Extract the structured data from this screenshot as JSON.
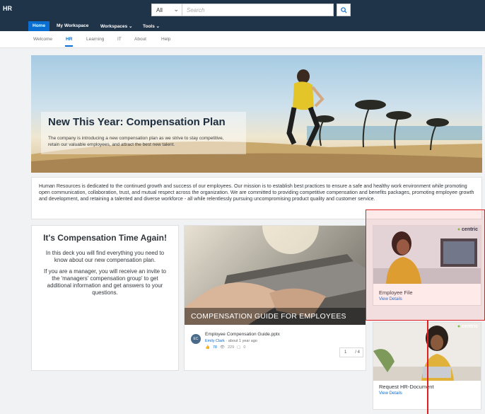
{
  "app": {
    "title": "HR"
  },
  "search": {
    "scope": "All",
    "placeholder": "Search"
  },
  "nav": {
    "items": [
      "Home",
      "My Workspace",
      "Workspaces ⌄",
      "Tools ⌄"
    ]
  },
  "subnav": {
    "items": [
      "Welcome",
      "HR",
      "Learning",
      "IT",
      "About",
      "Help"
    ]
  },
  "hero": {
    "title": "New This Year: Compensation Plan",
    "subtitle": "The company is introducing a new compensation plan as we strive to stay competitive, retain our valuable employees, and attract the best new talent."
  },
  "mission": {
    "text": "Human Resources is dedicated to the continued growth and success of our employees. Our mission is to establish best practices to ensure a safe and healthy work environment while promoting open communication, collaboration, trust, and mutual respect across the organization. We are committed to providing competitive compensation and benefits packages, promoting employee growth and development, and retaining a talented and diverse workforce - all while relentlessly pursuing uncompromising product quality and customer service."
  },
  "comp_card": {
    "title": "It's Compensation Time Again!",
    "p1": "In this deck you will find everything you need to know about our new compensation plan.",
    "p2": "If you are a manager, you will receive an invite to the 'managers' compensation group' to get additional information and get answers to your questions."
  },
  "guide": {
    "banner": "COMPENSATION GUIDE FOR EMPLOYEES",
    "file": "Employee Compensation Guide.pptx",
    "author": "Emily Clark",
    "time": " · about 1 year ago",
    "avatar": "EC",
    "likes": "78",
    "views": "229",
    "comments": "0",
    "page": "1",
    "total": "/ 4"
  },
  "tiles": {
    "brand": "centric",
    "employee_file": {
      "label": "Employee File",
      "link": "View Details"
    },
    "request_doc": {
      "label": "Request HR-Document",
      "link": "View Details"
    }
  },
  "colors": {
    "shell": "#1f3349",
    "accent": "#0a6ed1",
    "highlight": "#e02020"
  }
}
